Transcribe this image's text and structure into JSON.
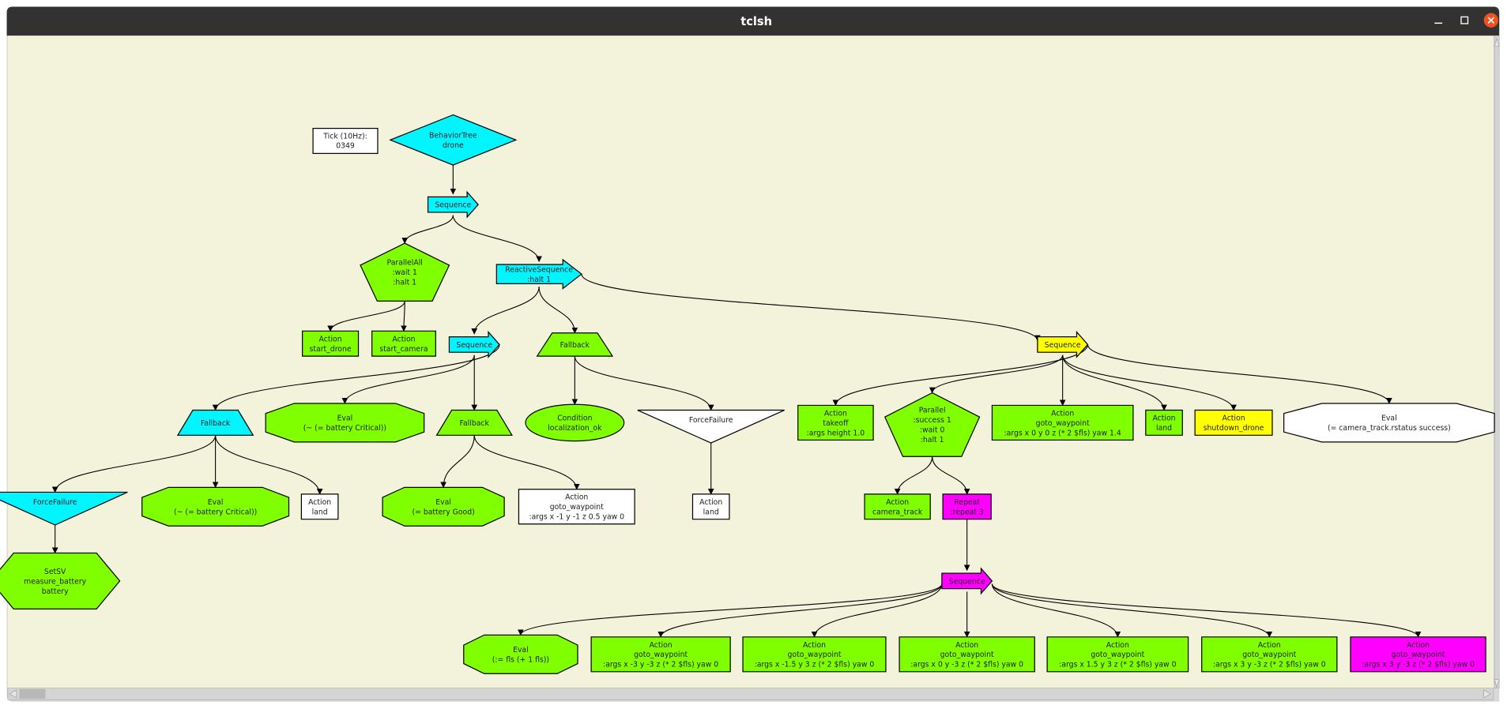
{
  "window": {
    "title": "tclsh",
    "controls": {
      "minimize": "minimize-icon",
      "maximize": "maximize-icon",
      "close": "close-icon"
    }
  },
  "colors": {
    "canvas_bg": "#f3f3dc",
    "titlebar_bg": "#333132",
    "close_button": "#e95420",
    "cyan": "#00f5ff",
    "green": "#80ff00",
    "yellow": "#ffff00",
    "magenta": "#ff00ff",
    "white": "#ffffff"
  },
  "tick": {
    "label": "Tick (10Hz):",
    "value": "0349"
  },
  "nodes": [
    {
      "id": "root",
      "shape": "diamond",
      "color": "cyan",
      "lines": [
        "BehaviorTree",
        "drone"
      ]
    },
    {
      "id": "seq1",
      "shape": "arrow",
      "color": "cyan",
      "lines": [
        "Sequence"
      ]
    },
    {
      "id": "parallelall",
      "shape": "pentagon",
      "color": "green",
      "lines": [
        "ParallelAll",
        ":wait 1",
        ":halt 1"
      ]
    },
    {
      "id": "reactive",
      "shape": "arrow",
      "color": "cyan",
      "lines": [
        "ReactiveSequence",
        ":halt 1"
      ]
    },
    {
      "id": "start_drone",
      "shape": "box",
      "color": "green",
      "lines": [
        "Action",
        "start_drone"
      ]
    },
    {
      "id": "start_camera",
      "shape": "box",
      "color": "green",
      "lines": [
        "Action",
        "start_camera"
      ]
    },
    {
      "id": "seq2",
      "shape": "arrow",
      "color": "cyan",
      "lines": [
        "Sequence"
      ]
    },
    {
      "id": "fallback_rs",
      "shape": "trapezium",
      "color": "green",
      "lines": [
        "Fallback"
      ]
    },
    {
      "id": "seq_yellow",
      "shape": "arrow",
      "color": "yellow",
      "lines": [
        "Sequence"
      ]
    },
    {
      "id": "fallback_left",
      "shape": "trapezium",
      "color": "cyan",
      "lines": [
        "Fallback"
      ]
    },
    {
      "id": "eval_not_critical_mid",
      "shape": "octagon",
      "color": "green",
      "lines": [
        "Eval",
        "(~ (= battery Critical))"
      ]
    },
    {
      "id": "fallback_mid",
      "shape": "trapezium",
      "color": "green",
      "lines": [
        "Fallback"
      ]
    },
    {
      "id": "condition_loc",
      "shape": "ellipse",
      "color": "green",
      "lines": [
        "Condition",
        "localization_ok"
      ]
    },
    {
      "id": "forcefailure_mid",
      "shape": "invtriangle",
      "color": "white",
      "lines": [
        "ForceFailure"
      ]
    },
    {
      "id": "takeoff",
      "shape": "box",
      "color": "green",
      "lines": [
        "Action",
        "takeoff",
        ":args height 1.0"
      ]
    },
    {
      "id": "parallel",
      "shape": "pentagon",
      "color": "green",
      "lines": [
        "Parallel",
        ":success 1",
        ":wait 0",
        ":halt 1"
      ]
    },
    {
      "id": "goto_0_0",
      "shape": "box",
      "color": "green",
      "lines": [
        "Action",
        "goto_waypoint",
        ":args x 0 y 0 z (* 2 $fls) yaw 1.4"
      ]
    },
    {
      "id": "land_y",
      "shape": "box",
      "color": "green",
      "lines": [
        "Action",
        "land"
      ]
    },
    {
      "id": "shutdown",
      "shape": "box",
      "color": "yellow",
      "lines": [
        "Action",
        "shutdown_drone"
      ]
    },
    {
      "id": "eval_camera",
      "shape": "octagon",
      "color": "white",
      "lines": [
        "Eval",
        "(= camera_track.rstatus success)"
      ]
    },
    {
      "id": "forcefailure_left",
      "shape": "invtriangle",
      "color": "cyan",
      "lines": [
        "ForceFailure"
      ]
    },
    {
      "id": "eval_not_critical_left",
      "shape": "octagon",
      "color": "green",
      "lines": [
        "Eval",
        "(~ (= battery Critical))"
      ]
    },
    {
      "id": "land_left",
      "shape": "box",
      "color": "white",
      "lines": [
        "Action",
        "land"
      ]
    },
    {
      "id": "eval_good",
      "shape": "octagon",
      "color": "green",
      "lines": [
        "Eval",
        "(= battery Good)"
      ]
    },
    {
      "id": "goto_m1",
      "shape": "box",
      "color": "white",
      "lines": [
        "Action",
        "goto_waypoint",
        ":args x -1 y -1 z 0.5 yaw 0"
      ]
    },
    {
      "id": "land_mid",
      "shape": "box",
      "color": "white",
      "lines": [
        "Action",
        "land"
      ]
    },
    {
      "id": "camera_track",
      "shape": "box",
      "color": "green",
      "lines": [
        "Action",
        "camera_track"
      ]
    },
    {
      "id": "repeat",
      "shape": "box",
      "color": "magenta",
      "lines": [
        "Repeat",
        ":repeat 3"
      ]
    },
    {
      "id": "setsv",
      "shape": "hexagon",
      "color": "green",
      "lines": [
        "SetSV",
        "measure_battery",
        "battery"
      ]
    },
    {
      "id": "seq_magenta",
      "shape": "arrow",
      "color": "magenta",
      "lines": [
        "Sequence"
      ]
    },
    {
      "id": "eval_fls",
      "shape": "octagon",
      "color": "green",
      "lines": [
        "Eval",
        "(:= fls (+ 1 fls))"
      ]
    },
    {
      "id": "wp1",
      "shape": "box",
      "color": "green",
      "lines": [
        "Action",
        "goto_waypoint",
        ":args x -3 y -3 z (* 2 $fls) yaw 0"
      ]
    },
    {
      "id": "wp2",
      "shape": "box",
      "color": "green",
      "lines": [
        "Action",
        "goto_waypoint",
        ":args x -1.5 y 3 z (* 2 $fls) yaw 0"
      ]
    },
    {
      "id": "wp3",
      "shape": "box",
      "color": "green",
      "lines": [
        "Action",
        "goto_waypoint",
        ":args x 0 y -3 z (* 2 $fls) yaw 0"
      ]
    },
    {
      "id": "wp4",
      "shape": "box",
      "color": "green",
      "lines": [
        "Action",
        "goto_waypoint",
        ":args x 1.5 y 3 z (* 2 $fls) yaw 0"
      ]
    },
    {
      "id": "wp5",
      "shape": "box",
      "color": "green",
      "lines": [
        "Action",
        "goto_waypoint",
        ":args x 3 y -3 z (* 2 $fls) yaw 0"
      ]
    },
    {
      "id": "wp6",
      "shape": "box",
      "color": "magenta",
      "lines": [
        "Action",
        "goto_waypoint",
        ":args x 3 y -3 z (* 2 $fls) yaw 0"
      ]
    }
  ],
  "edges": [
    [
      "root",
      "seq1"
    ],
    [
      "seq1",
      "parallelall"
    ],
    [
      "seq1",
      "reactive"
    ],
    [
      "parallelall",
      "start_drone"
    ],
    [
      "parallelall",
      "start_camera"
    ],
    [
      "reactive",
      "seq2"
    ],
    [
      "reactive",
      "fallback_rs"
    ],
    [
      "reactive",
      "seq_yellow"
    ],
    [
      "seq2",
      "fallback_left"
    ],
    [
      "seq2",
      "eval_not_critical_mid"
    ],
    [
      "seq2",
      "fallback_mid"
    ],
    [
      "fallback_rs",
      "condition_loc"
    ],
    [
      "fallback_rs",
      "forcefailure_mid"
    ],
    [
      "seq_yellow",
      "takeoff"
    ],
    [
      "seq_yellow",
      "parallel"
    ],
    [
      "seq_yellow",
      "goto_0_0"
    ],
    [
      "seq_yellow",
      "land_y"
    ],
    [
      "seq_yellow",
      "shutdown"
    ],
    [
      "seq_yellow",
      "eval_camera"
    ],
    [
      "fallback_left",
      "forcefailure_left"
    ],
    [
      "fallback_left",
      "eval_not_critical_left"
    ],
    [
      "fallback_left",
      "land_left"
    ],
    [
      "fallback_mid",
      "eval_good"
    ],
    [
      "fallback_mid",
      "goto_m1"
    ],
    [
      "forcefailure_mid",
      "land_mid"
    ],
    [
      "parallel",
      "camera_track"
    ],
    [
      "parallel",
      "repeat"
    ],
    [
      "forcefailure_left",
      "setsv"
    ],
    [
      "repeat",
      "seq_magenta"
    ],
    [
      "seq_magenta",
      "eval_fls"
    ],
    [
      "seq_magenta",
      "wp1"
    ],
    [
      "seq_magenta",
      "wp2"
    ],
    [
      "seq_magenta",
      "wp3"
    ],
    [
      "seq_magenta",
      "wp4"
    ],
    [
      "seq_magenta",
      "wp5"
    ],
    [
      "seq_magenta",
      "wp6"
    ]
  ]
}
